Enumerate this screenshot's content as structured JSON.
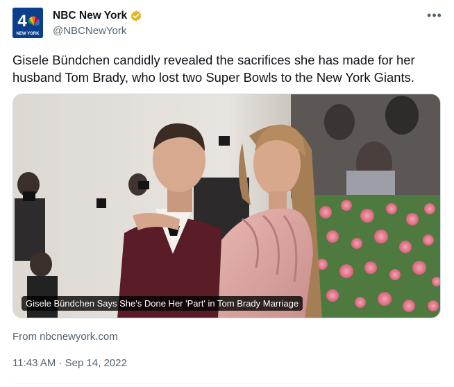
{
  "author": {
    "name": "NBC New York",
    "handle": "@NBCNewYork",
    "logo_number": "4",
    "logo_text": "NEW YORK",
    "verified_color": "#e2b719"
  },
  "tweet": {
    "text": "Gisele Bündchen candidly revealed the sacrifices she has made for her husband Tom Brady, who lost two Super Bowls to the New York Giants."
  },
  "media": {
    "caption": "Gisele Bündchen Says She's Done Her 'Part' in Tom Brady Marriage"
  },
  "link_card": {
    "source": "From nbcnewyork.com"
  },
  "meta": {
    "timestamp": "11:43 AM · Sep 14, 2022"
  },
  "colors": {
    "text_primary": "#0f1419",
    "text_secondary": "#536471",
    "border": "#cfd9de"
  }
}
